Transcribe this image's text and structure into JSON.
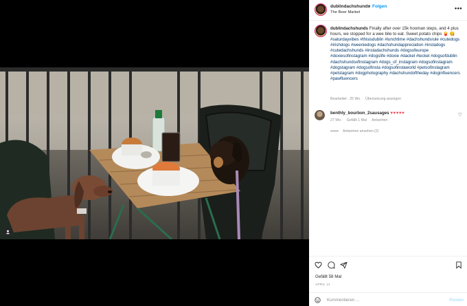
{
  "post": {
    "username": "dublindachshunds",
    "separator": "•",
    "follow_label": "Folgen",
    "location": "The Beer Market",
    "more_icon": "more-horizontal-icon"
  },
  "caption": {
    "username": "dublindachshunds",
    "text": "Finally after over 15k hooman steps, and 4 plus hours, we stopped for a wee bite to eat. Sweet potato chips 🍟 😋",
    "hashtags": "#saturdayvibes #thisisdublin #lunchtime #dachshundsrule #cutedogs #irishdogs #weeniedogs #dachshundappreciation #instadogs #cutedachshunds #instadachshunds #dogsofeurope #doxiesofinstagram #dogslife #doxie #dackel #teckel #dogsofdublin #dachshundsofinstagram #dogs_of_instagram #dogsofinstagram #dogstagram #dogsofinsta #dogsofinstaworld #petsofinstagram #petstagram #dogphotography #dachshundoftheday #doginfluencers #pawfluencers",
    "edited": "Bearbeitet · 25 Wo.",
    "translate": "Übersetzung anzeigen"
  },
  "comment": {
    "username": "benthly_bourbon_2sausages",
    "text": "♥♥♥♥♥",
    "age": "27 Wo.",
    "likes": "Gefällt 1 Mal",
    "reply": "Antworten",
    "view_replies": "Antworten ansehen (2)"
  },
  "actions": {
    "like_icon": "heart-icon",
    "comment_icon": "comment-icon",
    "share_icon": "share-icon",
    "save_icon": "bookmark-icon",
    "likes_text": "Gefällt 58 Mal",
    "date": "APRIL 12"
  },
  "comment_box": {
    "placeholder": "Kommentieren ...",
    "post_label": "Posten"
  }
}
